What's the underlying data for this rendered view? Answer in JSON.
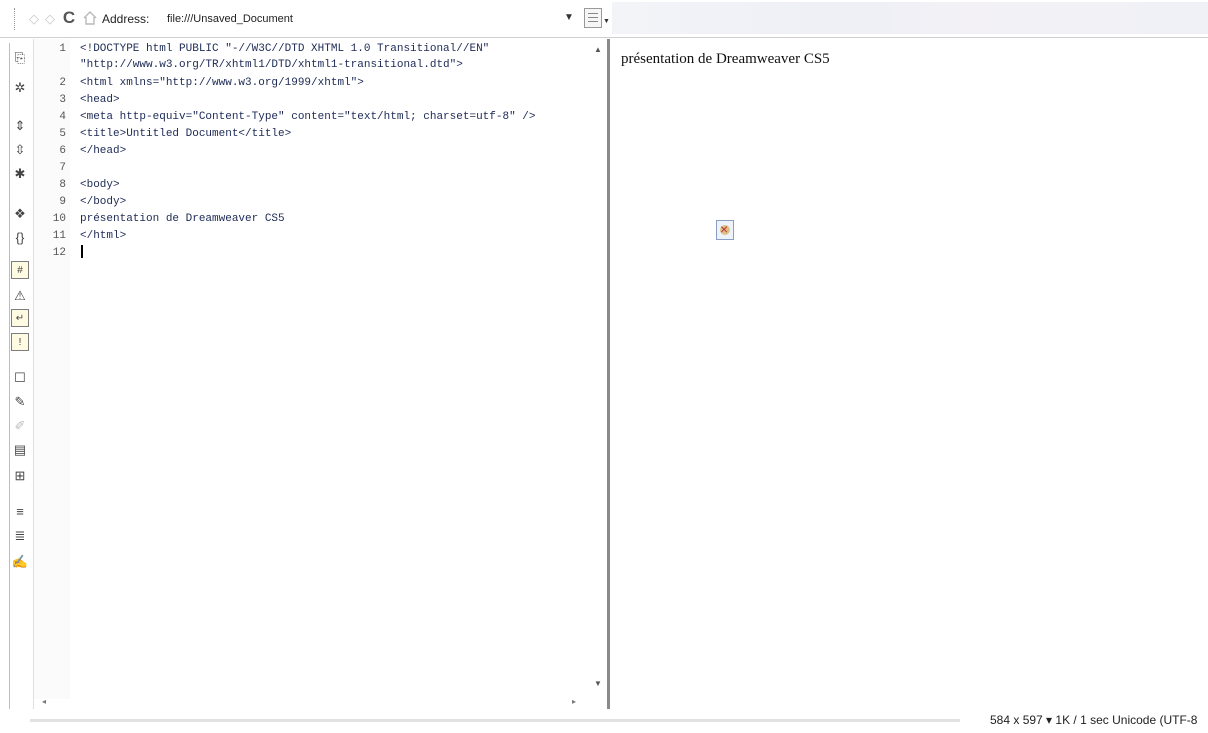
{
  "address_bar": {
    "back_icon": "back-arrow-icon",
    "forward_icon": "forward-arrow-icon",
    "refresh_icon": "refresh-icon",
    "home_icon": "home-icon",
    "label": "Address:",
    "url": "file:///Unsaved_Document"
  },
  "code_view": {
    "lines": [
      {
        "n": "1",
        "text": "<!DOCTYPE html PUBLIC \"-//W3C//DTD XHTML 1.0 Transitional//EN\""
      },
      {
        "n": "",
        "text": "\"http://www.w3.org/TR/xhtml1/DTD/xhtml1-transitional.dtd\">"
      },
      {
        "n": "2",
        "text": "<html xmlns=\"http://www.w3.org/1999/xhtml\">"
      },
      {
        "n": "3",
        "text": "<head>"
      },
      {
        "n": "4",
        "text": "<meta http-equiv=\"Content-Type\" content=\"text/html; charset=utf-8\" />"
      },
      {
        "n": "5",
        "text": "<title>Untitled Document</title>"
      },
      {
        "n": "6",
        "text": "</head>"
      },
      {
        "n": "7",
        "text": ""
      },
      {
        "n": "8",
        "text": "<body>"
      },
      {
        "n": "9",
        "text": "</body>"
      },
      {
        "n": "10",
        "text": "présentation de Dreamweaver CS5"
      },
      {
        "n": "11",
        "text": "</html>"
      },
      {
        "n": "12",
        "text": ""
      }
    ]
  },
  "design_view": {
    "text": "présentation de Dreamweaver CS5"
  },
  "status_bar": {
    "text": "584 x 597 ▾  1K / 1 sec  Unicode (UTF-8"
  }
}
